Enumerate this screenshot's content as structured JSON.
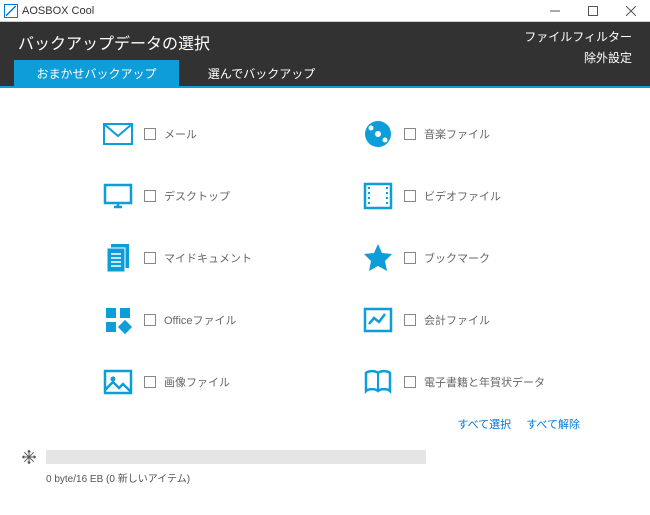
{
  "window": {
    "title": "AOSBOX Cool"
  },
  "header": {
    "title": "バックアップデータの選択",
    "file_filter": "ファイルフィルター",
    "exclude_settings": "除外設定"
  },
  "tabs": {
    "auto": "おまかせバックアップ",
    "manual": "選んでバックアップ"
  },
  "categories": {
    "mail": "メール",
    "music": "音楽ファイル",
    "desktop": "デスクトップ",
    "video": "ビデオファイル",
    "documents": "マイドキュメント",
    "bookmark": "ブックマーク",
    "office": "Officeファイル",
    "finance": "会計ファイル",
    "image": "画像ファイル",
    "ebook": "電子書籍と年賀状データ"
  },
  "actions": {
    "select_all": "すべて選択",
    "clear_all": "すべて解除"
  },
  "status": "0 byte/16 EB (0 新しいアイテム)"
}
